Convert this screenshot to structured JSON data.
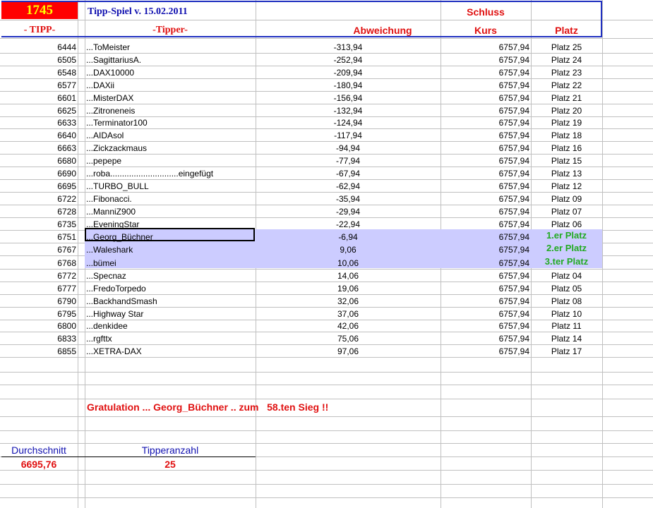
{
  "header": {
    "tipp_count": "1745",
    "title": "Tipp-Spiel v. 15.02.2011",
    "col_tipp": "- TIPP-",
    "col_tipper": "-Tipper-",
    "col_abweichung": "Abweichung",
    "col_schluss": "Schluss",
    "col_kurs": "Kurs",
    "col_platz": "Platz"
  },
  "rows": [
    {
      "tipp": "6444",
      "tipper": "...ToMeister",
      "abw": "-313,94",
      "kurs": "6757,94",
      "platz": "Platz 25"
    },
    {
      "tipp": "6505",
      "tipper": "...SagittariusA.",
      "abw": "-252,94",
      "kurs": "6757,94",
      "platz": "Platz 24"
    },
    {
      "tipp": "6548",
      "tipper": "...DAX10000",
      "abw": "-209,94",
      "kurs": "6757,94",
      "platz": "Platz 23"
    },
    {
      "tipp": "6577",
      "tipper": "...DAXii",
      "abw": "-180,94",
      "kurs": "6757,94",
      "platz": "Platz 22"
    },
    {
      "tipp": "6601",
      "tipper": "...MisterDAX",
      "abw": "-156,94",
      "kurs": "6757,94",
      "platz": "Platz 21"
    },
    {
      "tipp": "6625",
      "tipper": "...Zitroneneis",
      "abw": "-132,94",
      "kurs": "6757,94",
      "platz": "Platz 20"
    },
    {
      "tipp": "6633",
      "tipper": "...Terminator100",
      "abw": "-124,94",
      "kurs": "6757,94",
      "platz": "Platz 19"
    },
    {
      "tipp": "6640",
      "tipper": "...AIDAsol",
      "abw": "-117,94",
      "kurs": "6757,94",
      "platz": "Platz 18"
    },
    {
      "tipp": "6663",
      "tipper": "...Zickzackmaus",
      "abw": "-94,94",
      "kurs": "6757,94",
      "platz": "Platz 16"
    },
    {
      "tipp": "6680",
      "tipper": "...pepepe",
      "abw": "-77,94",
      "kurs": "6757,94",
      "platz": "Platz 15"
    },
    {
      "tipp": "6690",
      "tipper": "...roba.............................eingefügt",
      "abw": "-67,94",
      "kurs": "6757,94",
      "platz": "Platz 13"
    },
    {
      "tipp": "6695",
      "tipper": "...TURBO_BULL",
      "abw": "-62,94",
      "kurs": "6757,94",
      "platz": "Platz 12"
    },
    {
      "tipp": "6722",
      "tipper": "...Fibonacci.",
      "abw": "-35,94",
      "kurs": "6757,94",
      "platz": "Platz 09"
    },
    {
      "tipp": "6728",
      "tipper": "...ManniZ900",
      "abw": "-29,94",
      "kurs": "6757,94",
      "platz": "Platz 07"
    },
    {
      "tipp": "6735",
      "tipper": "...EveningStar",
      "abw": "-22,94",
      "kurs": "6757,94",
      "platz": "Platz 06"
    },
    {
      "tipp": "6751",
      "tipper": "...Georg_Büchner",
      "abw": "-6,94",
      "kurs": "6757,94",
      "platz": "1.er Platz"
    },
    {
      "tipp": "6767",
      "tipper": "...Waleshark",
      "abw": "9,06",
      "kurs": "6757,94",
      "platz": "2.er Platz"
    },
    {
      "tipp": "6768",
      "tipper": "...bümei",
      "abw": "10,06",
      "kurs": "6757,94",
      "platz": "3.ter Platz"
    },
    {
      "tipp": "6772",
      "tipper": "...Specnaz",
      "abw": "14,06",
      "kurs": "6757,94",
      "platz": "Platz 04"
    },
    {
      "tipp": "6777",
      "tipper": "...FredoTorpedo",
      "abw": "19,06",
      "kurs": "6757,94",
      "platz": "Platz 05"
    },
    {
      "tipp": "6790",
      "tipper": "...BackhandSmash",
      "abw": "32,06",
      "kurs": "6757,94",
      "platz": "Platz 08"
    },
    {
      "tipp": "6795",
      "tipper": "...Highway Star",
      "abw": "37,06",
      "kurs": "6757,94",
      "platz": "Platz 10"
    },
    {
      "tipp": "6800",
      "tipper": "...denkidee",
      "abw": "42,06",
      "kurs": "6757,94",
      "platz": "Platz 11"
    },
    {
      "tipp": "6833",
      "tipper": "...rgfttx",
      "abw": "75,06",
      "kurs": "6757,94",
      "platz": "Platz 14"
    },
    {
      "tipp": "6855",
      "tipper": "...XETRA-DAX",
      "abw": "97,06",
      "kurs": "6757,94",
      "platz": "Platz 17"
    }
  ],
  "footer": {
    "congrats": "Gratulation ... Georg_Büchner .. zum   58.ten Sieg !!",
    "avg_label": "Durchschnitt",
    "avg_value": "6695,76",
    "count_label": "Tipperanzahl",
    "count_value": "25"
  }
}
